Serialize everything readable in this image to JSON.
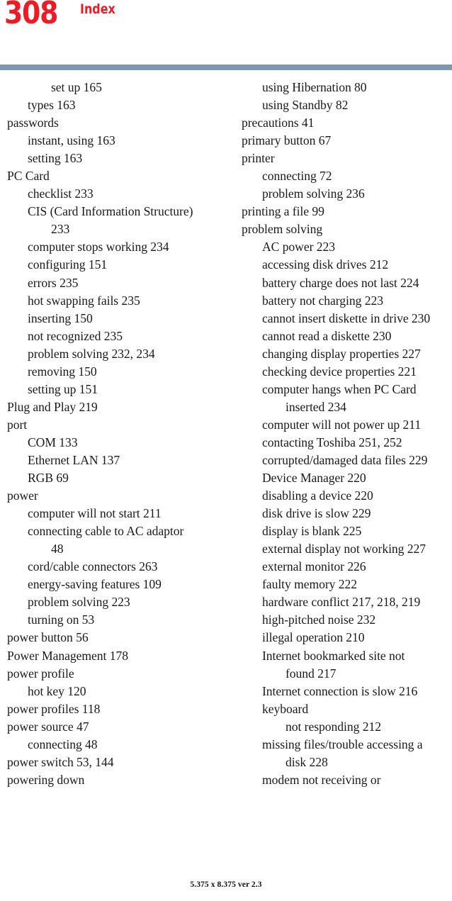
{
  "header": {
    "page_number": "308",
    "section_title": "Index",
    "rule_color": "#7d97b2",
    "accent_color": "#ee1b24"
  },
  "footer": {
    "text": "5.375 x 8.375 ver 2.3"
  },
  "columns": {
    "left": [
      {
        "level": 2,
        "text": "set up 165"
      },
      {
        "level": 1,
        "text": "types 163"
      },
      {
        "level": 0,
        "text": "passwords"
      },
      {
        "level": 1,
        "text": "instant, using 163"
      },
      {
        "level": 1,
        "text": "setting 163"
      },
      {
        "level": 0,
        "text": "PC Card"
      },
      {
        "level": 1,
        "text": "checklist 233"
      },
      {
        "level": 1,
        "text": "CIS (Card Information Structure)"
      },
      {
        "level": 2,
        "text": "233"
      },
      {
        "level": 1,
        "text": "computer stops working 234"
      },
      {
        "level": 1,
        "text": "configuring 151"
      },
      {
        "level": 1,
        "text": "errors 235"
      },
      {
        "level": 1,
        "text": "hot swapping fails 235"
      },
      {
        "level": 1,
        "text": "inserting 150"
      },
      {
        "level": 1,
        "text": "not recognized 235"
      },
      {
        "level": 1,
        "text": "problem solving 232, 234"
      },
      {
        "level": 1,
        "text": "removing 150"
      },
      {
        "level": 1,
        "text": "setting up 151"
      },
      {
        "level": 0,
        "text": "Plug and Play 219"
      },
      {
        "level": 0,
        "text": "port"
      },
      {
        "level": 1,
        "text": "COM 133"
      },
      {
        "level": 1,
        "text": "Ethernet LAN 137"
      },
      {
        "level": 1,
        "text": "RGB 69"
      },
      {
        "level": 0,
        "text": "power"
      },
      {
        "level": 1,
        "text": "computer will not start 211"
      },
      {
        "level": 1,
        "text": "connecting cable to AC adaptor"
      },
      {
        "level": 2,
        "text": "48"
      },
      {
        "level": 1,
        "text": "cord/cable connectors 263"
      },
      {
        "level": 1,
        "text": "energy-saving features 109"
      },
      {
        "level": 1,
        "text": "problem solving 223"
      },
      {
        "level": 1,
        "text": "turning on 53"
      },
      {
        "level": 0,
        "text": "power button 56"
      },
      {
        "level": 0,
        "text": "Power Management 178"
      },
      {
        "level": 0,
        "text": "power profile"
      },
      {
        "level": 1,
        "text": "hot key 120"
      },
      {
        "level": 0,
        "text": "power profiles 118"
      },
      {
        "level": 0,
        "text": "power source 47"
      },
      {
        "level": 1,
        "text": "connecting 48"
      },
      {
        "level": 0,
        "text": "power switch 53, 144"
      },
      {
        "level": 0,
        "text": "powering down"
      }
    ],
    "right": [
      {
        "level": 1,
        "text": "using Hibernation 80"
      },
      {
        "level": 1,
        "text": "using Standby 82"
      },
      {
        "level": 0,
        "text": "precautions 41"
      },
      {
        "level": 0,
        "text": "primary button 67"
      },
      {
        "level": 0,
        "text": "printer"
      },
      {
        "level": 1,
        "text": "connecting 72"
      },
      {
        "level": 1,
        "text": "problem solving 236"
      },
      {
        "level": 0,
        "text": "printing a file 99"
      },
      {
        "level": 0,
        "text": "problem solving"
      },
      {
        "level": 1,
        "text": "AC power 223"
      },
      {
        "level": 1,
        "text": "accessing disk drives 212"
      },
      {
        "level": 1,
        "text": "battery charge does not last 224"
      },
      {
        "level": 1,
        "text": "battery not charging 223"
      },
      {
        "level": 1,
        "text": "cannot insert diskette in drive 230"
      },
      {
        "level": 1,
        "text": "cannot read a diskette 230"
      },
      {
        "level": 1,
        "text": "changing display properties 227"
      },
      {
        "level": 1,
        "text": "checking device properties 221"
      },
      {
        "level": 1,
        "text": "computer hangs when PC Card"
      },
      {
        "level": 2,
        "text": "inserted 234"
      },
      {
        "level": 1,
        "text": "computer will not power up 211"
      },
      {
        "level": 1,
        "text": "contacting Toshiba 251, 252"
      },
      {
        "level": 1,
        "text": "corrupted/damaged data files 229"
      },
      {
        "level": 1,
        "text": "Device Manager 220"
      },
      {
        "level": 1,
        "text": "disabling a device 220"
      },
      {
        "level": 1,
        "text": "disk drive is slow 229"
      },
      {
        "level": 1,
        "text": "display is blank 225"
      },
      {
        "level": 1,
        "text": "external display not working 227"
      },
      {
        "level": 1,
        "text": "external monitor 226"
      },
      {
        "level": 1,
        "text": "faulty memory 222"
      },
      {
        "level": 1,
        "text": "hardware conflict 217, 218, 219"
      },
      {
        "level": 1,
        "text": "high-pitched noise 232"
      },
      {
        "level": 1,
        "text": "illegal operation 210"
      },
      {
        "level": 1,
        "text": "Internet bookmarked site not"
      },
      {
        "level": 2,
        "text": "found 217"
      },
      {
        "level": 1,
        "text": "Internet connection is slow 216"
      },
      {
        "level": 1,
        "text": "keyboard"
      },
      {
        "level": 2,
        "text": "not responding 212"
      },
      {
        "level": 1,
        "text": "missing files/trouble accessing a"
      },
      {
        "level": 2,
        "text": "disk 228"
      },
      {
        "level": 1,
        "text": "modem not receiving or"
      }
    ]
  }
}
